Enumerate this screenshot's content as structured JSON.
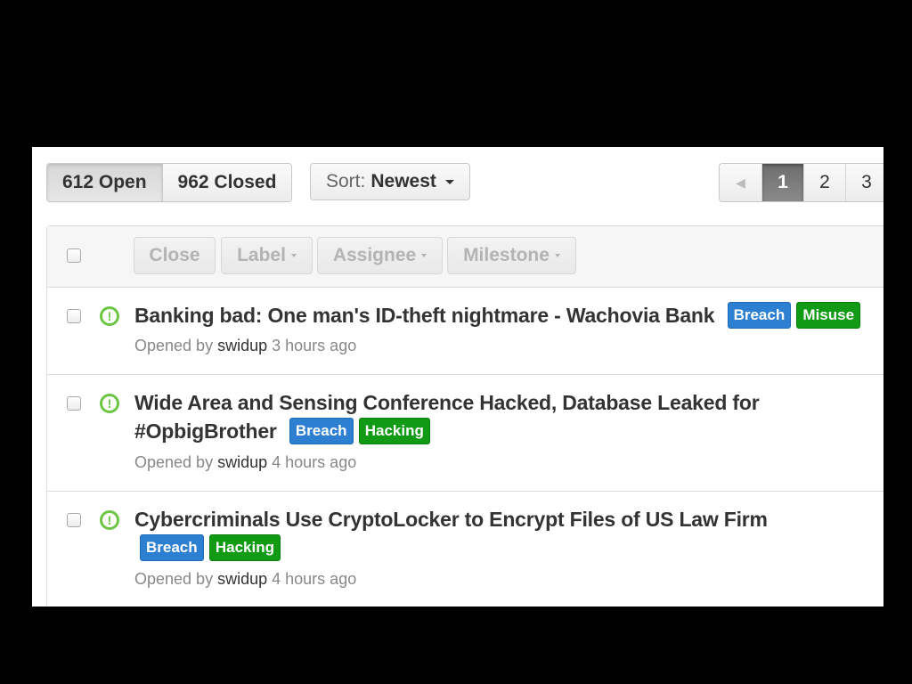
{
  "states": {
    "open_label": "612 Open",
    "closed_label": "962 Closed"
  },
  "sort": {
    "prefix": "Sort:",
    "value": "Newest"
  },
  "pagination": {
    "prev_icon": "◀",
    "pages": [
      "1",
      "2",
      "3"
    ],
    "current": "1"
  },
  "bulk_actions": {
    "close": "Close",
    "label": "Label",
    "assignee": "Assignee",
    "milestone": "Milestone"
  },
  "issues": [
    {
      "title": "Banking bad: One man's ID-theft nightmare - Wachovia Bank",
      "labels": [
        "Breach",
        "Misuse"
      ],
      "opened_prefix": "Opened by",
      "author": "swidup",
      "time": "3 hours ago"
    },
    {
      "title_line1": "Wide Area and Sensing Conference Hacked, Database Leaked for",
      "title_line2": "#OpbigBrother",
      "labels": [
        "Breach",
        "Hacking"
      ],
      "opened_prefix": "Opened by",
      "author": "swidup",
      "time": "4 hours ago"
    },
    {
      "title": "Cybercriminals Use CryptoLocker to Encrypt Files of US Law Firm",
      "labels": [
        "Breach",
        "Hacking"
      ],
      "opened_prefix": "Opened by",
      "author": "swidup",
      "time": "4 hours ago"
    }
  ],
  "colors": {
    "open_icon": "#6cc644",
    "label_breach": "#2d7fd2",
    "label_green": "#119a14",
    "background": "#000000"
  }
}
